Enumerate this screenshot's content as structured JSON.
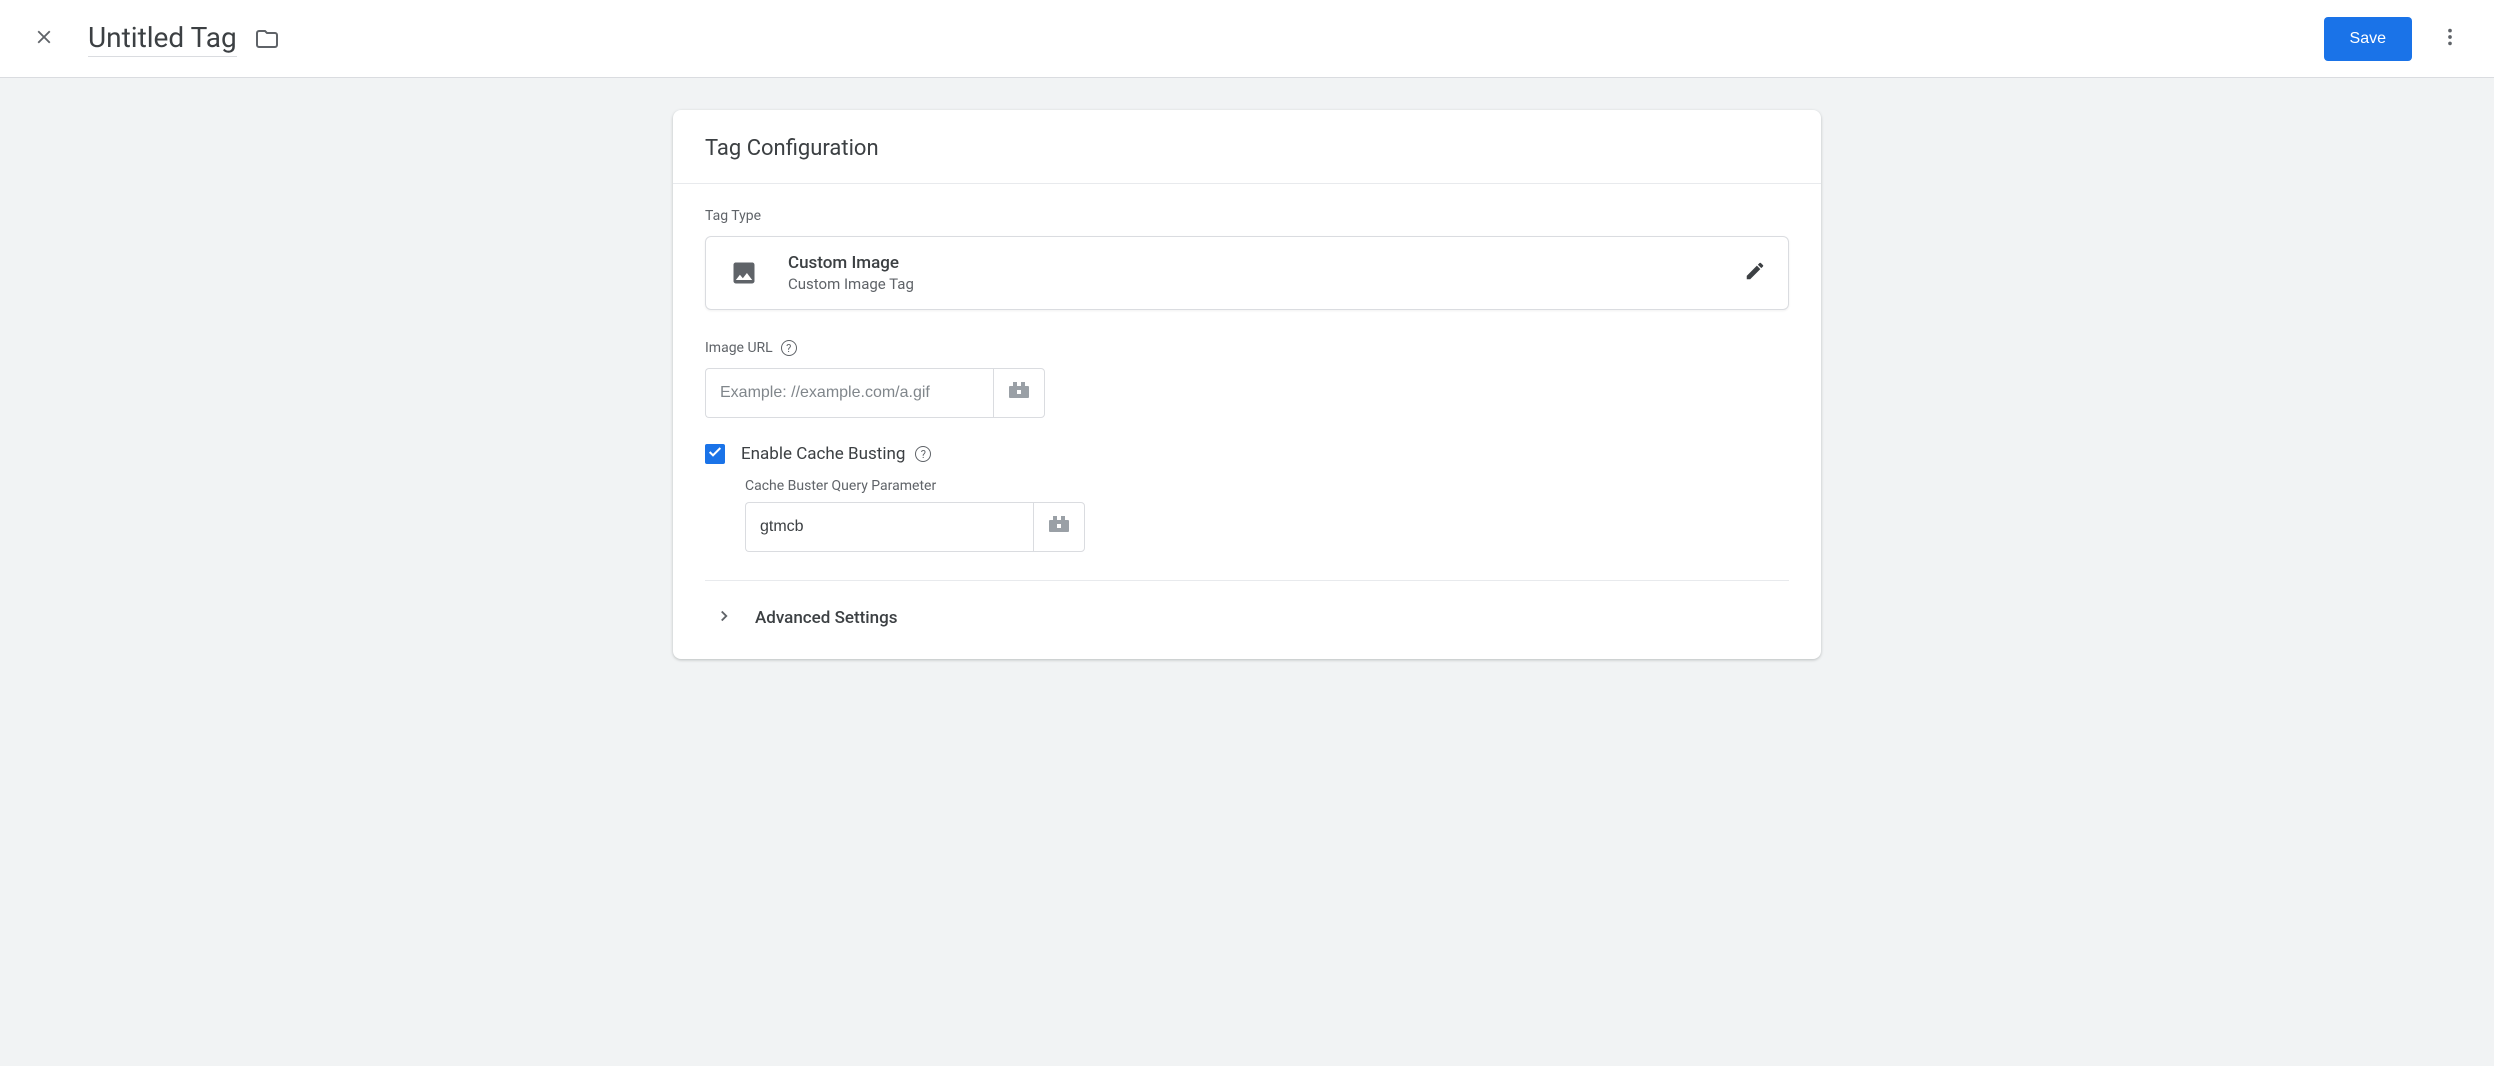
{
  "header": {
    "title": "Untitled Tag",
    "save_label": "Save"
  },
  "card": {
    "title": "Tag Configuration"
  },
  "tag_type": {
    "section_label": "Tag Type",
    "name": "Custom Image",
    "subtitle": "Custom Image Tag"
  },
  "image_url": {
    "label": "Image URL",
    "placeholder": "Example: //example.com/a.gif",
    "value": ""
  },
  "cache_busting": {
    "enabled": true,
    "label": "Enable Cache Busting",
    "param_label": "Cache Buster Query Parameter",
    "param_value": "gtmcb"
  },
  "advanced": {
    "label": "Advanced Settings"
  }
}
